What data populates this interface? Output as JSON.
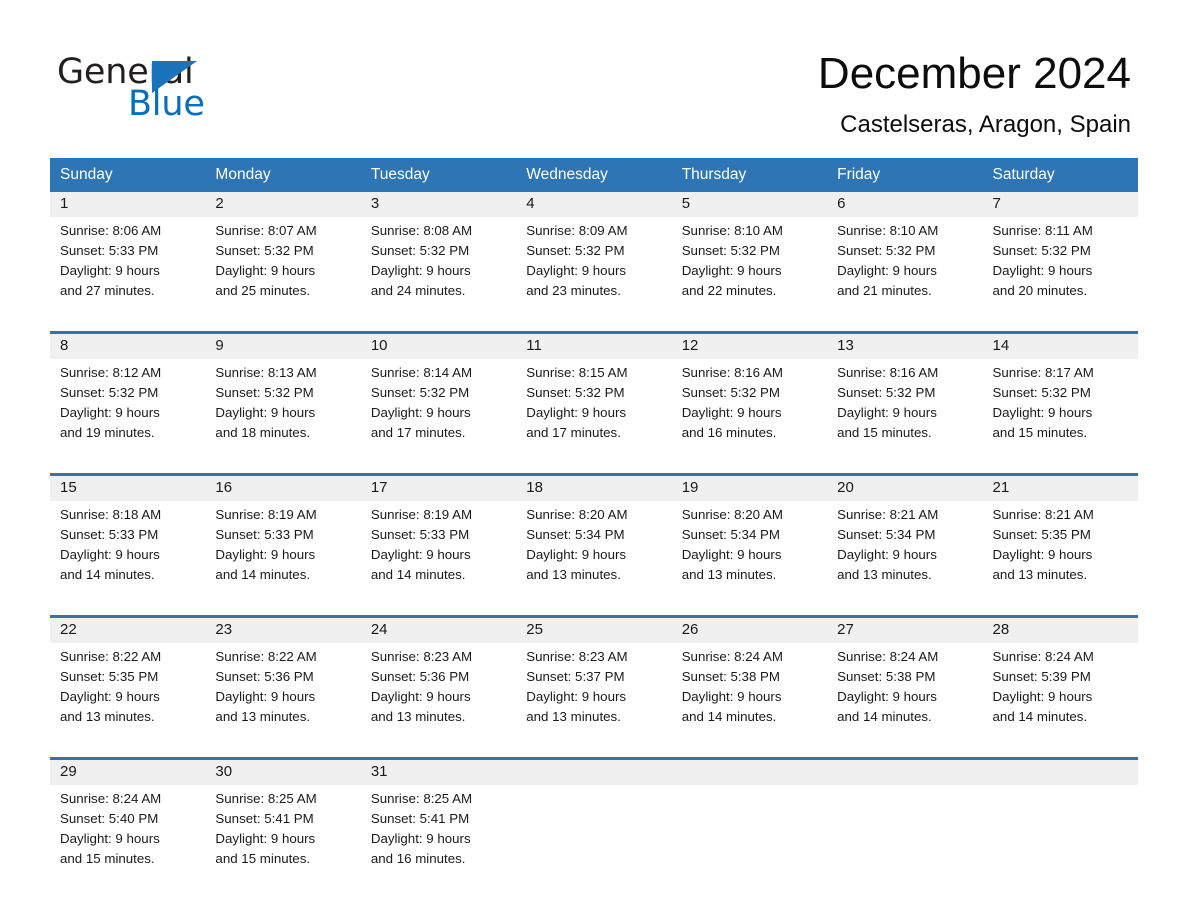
{
  "logo": {
    "word_one": "General",
    "word_two": "Blue",
    "triangle_color": "#1b74bb",
    "blue_color": "#0a6ebd"
  },
  "header": {
    "title": "December 2024",
    "location": "Castelseras, Aragon, Spain"
  },
  "theme": {
    "header_blue": "#2e75b6",
    "daynum_band": "#f0f0f0",
    "text": "#1a1a1a"
  },
  "weekdays": [
    "Sunday",
    "Monday",
    "Tuesday",
    "Wednesday",
    "Thursday",
    "Friday",
    "Saturday"
  ],
  "weeks": [
    [
      {
        "day": "1",
        "sunrise": "Sunrise: 8:06 AM",
        "sunset": "Sunset: 5:33 PM",
        "daylight1": "Daylight: 9 hours",
        "daylight2": "and 27 minutes."
      },
      {
        "day": "2",
        "sunrise": "Sunrise: 8:07 AM",
        "sunset": "Sunset: 5:32 PM",
        "daylight1": "Daylight: 9 hours",
        "daylight2": "and 25 minutes."
      },
      {
        "day": "3",
        "sunrise": "Sunrise: 8:08 AM",
        "sunset": "Sunset: 5:32 PM",
        "daylight1": "Daylight: 9 hours",
        "daylight2": "and 24 minutes."
      },
      {
        "day": "4",
        "sunrise": "Sunrise: 8:09 AM",
        "sunset": "Sunset: 5:32 PM",
        "daylight1": "Daylight: 9 hours",
        "daylight2": "and 23 minutes."
      },
      {
        "day": "5",
        "sunrise": "Sunrise: 8:10 AM",
        "sunset": "Sunset: 5:32 PM",
        "daylight1": "Daylight: 9 hours",
        "daylight2": "and 22 minutes."
      },
      {
        "day": "6",
        "sunrise": "Sunrise: 8:10 AM",
        "sunset": "Sunset: 5:32 PM",
        "daylight1": "Daylight: 9 hours",
        "daylight2": "and 21 minutes."
      },
      {
        "day": "7",
        "sunrise": "Sunrise: 8:11 AM",
        "sunset": "Sunset: 5:32 PM",
        "daylight1": "Daylight: 9 hours",
        "daylight2": "and 20 minutes."
      }
    ],
    [
      {
        "day": "8",
        "sunrise": "Sunrise: 8:12 AM",
        "sunset": "Sunset: 5:32 PM",
        "daylight1": "Daylight: 9 hours",
        "daylight2": "and 19 minutes."
      },
      {
        "day": "9",
        "sunrise": "Sunrise: 8:13 AM",
        "sunset": "Sunset: 5:32 PM",
        "daylight1": "Daylight: 9 hours",
        "daylight2": "and 18 minutes."
      },
      {
        "day": "10",
        "sunrise": "Sunrise: 8:14 AM",
        "sunset": "Sunset: 5:32 PM",
        "daylight1": "Daylight: 9 hours",
        "daylight2": "and 17 minutes."
      },
      {
        "day": "11",
        "sunrise": "Sunrise: 8:15 AM",
        "sunset": "Sunset: 5:32 PM",
        "daylight1": "Daylight: 9 hours",
        "daylight2": "and 17 minutes."
      },
      {
        "day": "12",
        "sunrise": "Sunrise: 8:16 AM",
        "sunset": "Sunset: 5:32 PM",
        "daylight1": "Daylight: 9 hours",
        "daylight2": "and 16 minutes."
      },
      {
        "day": "13",
        "sunrise": "Sunrise: 8:16 AM",
        "sunset": "Sunset: 5:32 PM",
        "daylight1": "Daylight: 9 hours",
        "daylight2": "and 15 minutes."
      },
      {
        "day": "14",
        "sunrise": "Sunrise: 8:17 AM",
        "sunset": "Sunset: 5:32 PM",
        "daylight1": "Daylight: 9 hours",
        "daylight2": "and 15 minutes."
      }
    ],
    [
      {
        "day": "15",
        "sunrise": "Sunrise: 8:18 AM",
        "sunset": "Sunset: 5:33 PM",
        "daylight1": "Daylight: 9 hours",
        "daylight2": "and 14 minutes."
      },
      {
        "day": "16",
        "sunrise": "Sunrise: 8:19 AM",
        "sunset": "Sunset: 5:33 PM",
        "daylight1": "Daylight: 9 hours",
        "daylight2": "and 14 minutes."
      },
      {
        "day": "17",
        "sunrise": "Sunrise: 8:19 AM",
        "sunset": "Sunset: 5:33 PM",
        "daylight1": "Daylight: 9 hours",
        "daylight2": "and 14 minutes."
      },
      {
        "day": "18",
        "sunrise": "Sunrise: 8:20 AM",
        "sunset": "Sunset: 5:34 PM",
        "daylight1": "Daylight: 9 hours",
        "daylight2": "and 13 minutes."
      },
      {
        "day": "19",
        "sunrise": "Sunrise: 8:20 AM",
        "sunset": "Sunset: 5:34 PM",
        "daylight1": "Daylight: 9 hours",
        "daylight2": "and 13 minutes."
      },
      {
        "day": "20",
        "sunrise": "Sunrise: 8:21 AM",
        "sunset": "Sunset: 5:34 PM",
        "daylight1": "Daylight: 9 hours",
        "daylight2": "and 13 minutes."
      },
      {
        "day": "21",
        "sunrise": "Sunrise: 8:21 AM",
        "sunset": "Sunset: 5:35 PM",
        "daylight1": "Daylight: 9 hours",
        "daylight2": "and 13 minutes."
      }
    ],
    [
      {
        "day": "22",
        "sunrise": "Sunrise: 8:22 AM",
        "sunset": "Sunset: 5:35 PM",
        "daylight1": "Daylight: 9 hours",
        "daylight2": "and 13 minutes."
      },
      {
        "day": "23",
        "sunrise": "Sunrise: 8:22 AM",
        "sunset": "Sunset: 5:36 PM",
        "daylight1": "Daylight: 9 hours",
        "daylight2": "and 13 minutes."
      },
      {
        "day": "24",
        "sunrise": "Sunrise: 8:23 AM",
        "sunset": "Sunset: 5:36 PM",
        "daylight1": "Daylight: 9 hours",
        "daylight2": "and 13 minutes."
      },
      {
        "day": "25",
        "sunrise": "Sunrise: 8:23 AM",
        "sunset": "Sunset: 5:37 PM",
        "daylight1": "Daylight: 9 hours",
        "daylight2": "and 13 minutes."
      },
      {
        "day": "26",
        "sunrise": "Sunrise: 8:24 AM",
        "sunset": "Sunset: 5:38 PM",
        "daylight1": "Daylight: 9 hours",
        "daylight2": "and 14 minutes."
      },
      {
        "day": "27",
        "sunrise": "Sunrise: 8:24 AM",
        "sunset": "Sunset: 5:38 PM",
        "daylight1": "Daylight: 9 hours",
        "daylight2": "and 14 minutes."
      },
      {
        "day": "28",
        "sunrise": "Sunrise: 8:24 AM",
        "sunset": "Sunset: 5:39 PM",
        "daylight1": "Daylight: 9 hours",
        "daylight2": "and 14 minutes."
      }
    ],
    [
      {
        "day": "29",
        "sunrise": "Sunrise: 8:24 AM",
        "sunset": "Sunset: 5:40 PM",
        "daylight1": "Daylight: 9 hours",
        "daylight2": "and 15 minutes."
      },
      {
        "day": "30",
        "sunrise": "Sunrise: 8:25 AM",
        "sunset": "Sunset: 5:41 PM",
        "daylight1": "Daylight: 9 hours",
        "daylight2": "and 15 minutes."
      },
      {
        "day": "31",
        "sunrise": "Sunrise: 8:25 AM",
        "sunset": "Sunset: 5:41 PM",
        "daylight1": "Daylight: 9 hours",
        "daylight2": "and 16 minutes."
      },
      {
        "day": "",
        "sunrise": "",
        "sunset": "",
        "daylight1": "",
        "daylight2": ""
      },
      {
        "day": "",
        "sunrise": "",
        "sunset": "",
        "daylight1": "",
        "daylight2": ""
      },
      {
        "day": "",
        "sunrise": "",
        "sunset": "",
        "daylight1": "",
        "daylight2": ""
      },
      {
        "day": "",
        "sunrise": "",
        "sunset": "",
        "daylight1": "",
        "daylight2": ""
      }
    ]
  ]
}
